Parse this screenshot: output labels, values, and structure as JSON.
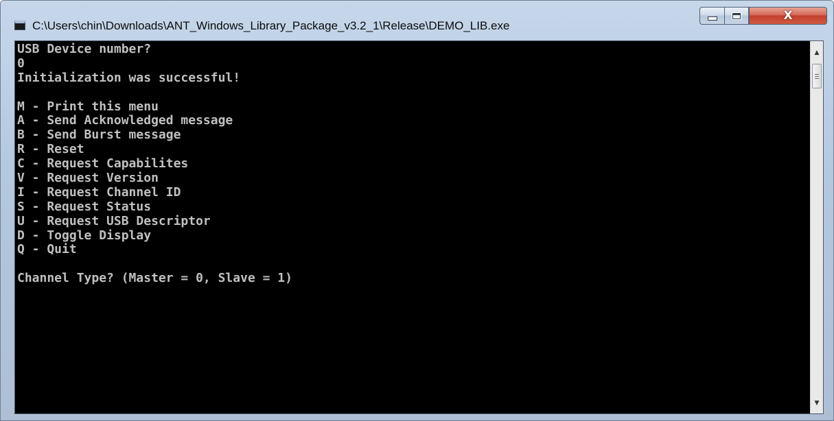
{
  "window": {
    "title": "C:\\Users\\chin\\Downloads\\ANT_Windows_Library_Package_v3.2_1\\Release\\DEMO_LIB.exe",
    "icon": "console-app-icon",
    "caption": {
      "minimize_icon": "minimize-icon",
      "maximize_icon": "maximize-icon",
      "close_label": "X"
    }
  },
  "console": {
    "lines": [
      "USB Device number?",
      "0",
      "Initialization was successful!",
      "",
      "M - Print this menu",
      "A - Send Acknowledged message",
      "B - Send Burst message",
      "R - Reset",
      "C - Request Capabilites",
      "V - Request Version",
      "I - Request Channel ID",
      "S - Request Status",
      "U - Request USB Descriptor",
      "D - Toggle Display",
      "Q - Quit",
      "",
      "Channel Type? (Master = 0, Slave = 1)"
    ]
  },
  "scrollbar": {
    "up_icon": "scroll-up-arrow-icon",
    "down_icon": "scroll-down-arrow-icon",
    "up_glyph": "▲",
    "down_glyph": "▼"
  },
  "colors": {
    "console_background": "#000000",
    "console_text": "#c0c0c0",
    "close_button": "#c7432f",
    "titlebar": "#b9cce2"
  }
}
